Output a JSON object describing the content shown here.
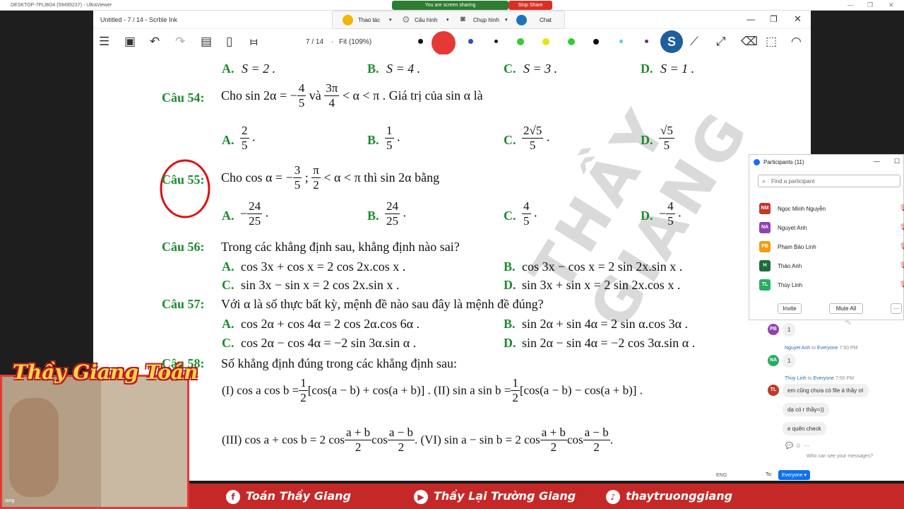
{
  "ultraviewer": {
    "title": "DESKTOP-7PLI8O4 (59495237) - UltraViewer",
    "sharing_label": "You are screen sharing",
    "stop_label": "Stop Share",
    "colors": {
      "share": "#2e7d32",
      "stop": "#d93025"
    }
  },
  "scrble": {
    "title": "Untitled - 7 / 14 - Scrble Ink",
    "page_indicator": "7 / 14",
    "zoom": "Fit (109%)",
    "pen_colors": [
      "#111111",
      "#2b4bcc",
      "#111111",
      "#33cc33",
      "#e6e60a",
      "#33cc33",
      "#111111",
      "#5ecfcf",
      "#6b2f8f"
    ]
  },
  "zoom_toolbar": {
    "items": [
      "Thao tác",
      "Cấu hình",
      "Chụp hình",
      "Chat"
    ]
  },
  "doc": {
    "prev_opts": [
      "A.",
      "S = 2 .",
      "B.",
      "S = 4 .",
      "C.",
      "S = 3 .",
      "D.",
      "S = 1 ."
    ],
    "q54": {
      "label": "Câu 54:",
      "text1": "Cho  sin 2α = −",
      "n1": "4",
      "d1": "5",
      "text2": " và ",
      "n2": "3π",
      "d2": "4",
      "text3": " < α < π . Giá trị của sin α  là"
    },
    "q54_opts": [
      {
        "key": "A.",
        "n": "2",
        "d": "5"
      },
      {
        "key": "B.",
        "n": "1",
        "d": "5"
      },
      {
        "key": "C.",
        "n": "2√5",
        "d": "5"
      },
      {
        "key": "D.",
        "n": "√5",
        "d": "5"
      }
    ],
    "q55": {
      "label": "Câu 55:",
      "text1": "Cho  cos α = −",
      "n1": "3",
      "d1": "5",
      "text2": " ; ",
      "n2": "π",
      "d2": "2",
      "text3": " < α < π  thì  sin 2α  bằng"
    },
    "q55_opts": [
      {
        "key": "A.",
        "sign": "−",
        "n": "24",
        "d": "25"
      },
      {
        "key": "B.",
        "sign": "",
        "n": "24",
        "d": "25"
      },
      {
        "key": "C.",
        "sign": "",
        "n": "4",
        "d": "5"
      },
      {
        "key": "D.",
        "sign": "−",
        "n": "4",
        "d": "5"
      }
    ],
    "q56": {
      "label": "Câu 56:",
      "text": "Trong các khẳng định sau, khẳng định nào sai?"
    },
    "q56_opts": [
      {
        "key": "A.",
        "text": "cos 3x + cos x = 2 cos 2x.cos x ."
      },
      {
        "key": "B.",
        "text": "cos 3x − cos x = 2 sin 2x.sin x ."
      },
      {
        "key": "C.",
        "text": "sin 3x − sin x = 2 cos 2x.sin x ."
      },
      {
        "key": "D.",
        "text": "sin 3x + sin x = 2 sin 2x.cos x ."
      }
    ],
    "q57": {
      "label": "Câu 57:",
      "text": "Với  α là số thực bất kỳ, mệnh đề nào sau đây là mệnh đề đúng?"
    },
    "q57_opts": [
      {
        "key": "A.",
        "text": "cos 2α + cos 4α = 2 cos 2α.cos 6α ."
      },
      {
        "key": "B.",
        "text": "sin 2α + sin 4α = 2 sin α.cos 3α ."
      },
      {
        "key": "C.",
        "text": "cos 2α − cos 4α = −2 sin 3α.sin α ."
      },
      {
        "key": "D.",
        "text": "sin 2α − sin 4α = −2 cos 3α.sin α ."
      }
    ],
    "q58": {
      "label": "Câu 58:",
      "text": "Số khẳng định đúng trong các khẳng định sau:"
    },
    "q58_l1a": "(I) cos a cos b =",
    "q58_l1b": "[cos(a − b) + cos(a + b)] . (II) sin a sin b =",
    "q58_l1c": "[cos(a − b) − cos(a + b)] .",
    "q58_half": {
      "n": "1",
      "d": "2"
    },
    "q58_l2a": "(III) cos a + cos b = 2 cos",
    "q58_l2b": "cos",
    "q58_l2c": ".  (VI) sin a − sin b = 2 cos",
    "q58_l2d": "cos",
    "q58_l2e": ".",
    "q58_f1": {
      "n": "a + b",
      "d": "2"
    },
    "q58_f2": {
      "n": "a − b",
      "d": "2"
    },
    "watermark": "THẦY GIANG"
  },
  "participants": {
    "title": "Participants (11)",
    "search_placeholder": "Find a participant",
    "rows": [
      {
        "initials": "NM",
        "name": "Ngọc Minh Nguyễn",
        "color": "#c0392b"
      },
      {
        "initials": "NA",
        "name": "Nguyet Anh",
        "color": "#8e44ad"
      },
      {
        "initials": "PB",
        "name": "Phạm Bảo Linh",
        "color": "#f39c12"
      },
      {
        "initials": "H",
        "name": "Thảo Anh",
        "color": "#1e6b3a"
      },
      {
        "initials": "TL",
        "name": "Thùy Linh",
        "color": "#27ae60"
      }
    ],
    "invite": "Invite",
    "mute_all": "Mute All",
    "more": "···"
  },
  "chat": {
    "m1": {
      "initials": "PB",
      "text": "1",
      "color": "#8e44ad"
    },
    "m2": {
      "sender": "Nguyet Anh",
      "to": "to",
      "target": "Everyone",
      "time": "7:50 PM",
      "initials": "NA",
      "text": "1",
      "color": "#27ae60"
    },
    "m3": {
      "sender": "Thùy Linh",
      "to": "to",
      "target": "Everyone",
      "time": "7:50 PM",
      "initials": "TL",
      "color": "#c0392b",
      "lines": [
        "em cũng chưa có file á thầy ơi",
        "dạ có r thầy=))",
        "e quên check"
      ]
    },
    "who_can_see": "Who can see your messages?",
    "to_label": "To:",
    "to_value": "Everyone"
  },
  "overlay": {
    "cam_brand": "Thầy Giang Toán",
    "cam_name": "iang",
    "banner": [
      {
        "icon": "f",
        "text": "Toán Thầy Giang"
      },
      {
        "icon": "▶",
        "text": "Thầy Lại Trường Giang"
      },
      {
        "icon": "♪",
        "text": "thaytruonggiang"
      }
    ],
    "tray": "ENG"
  }
}
